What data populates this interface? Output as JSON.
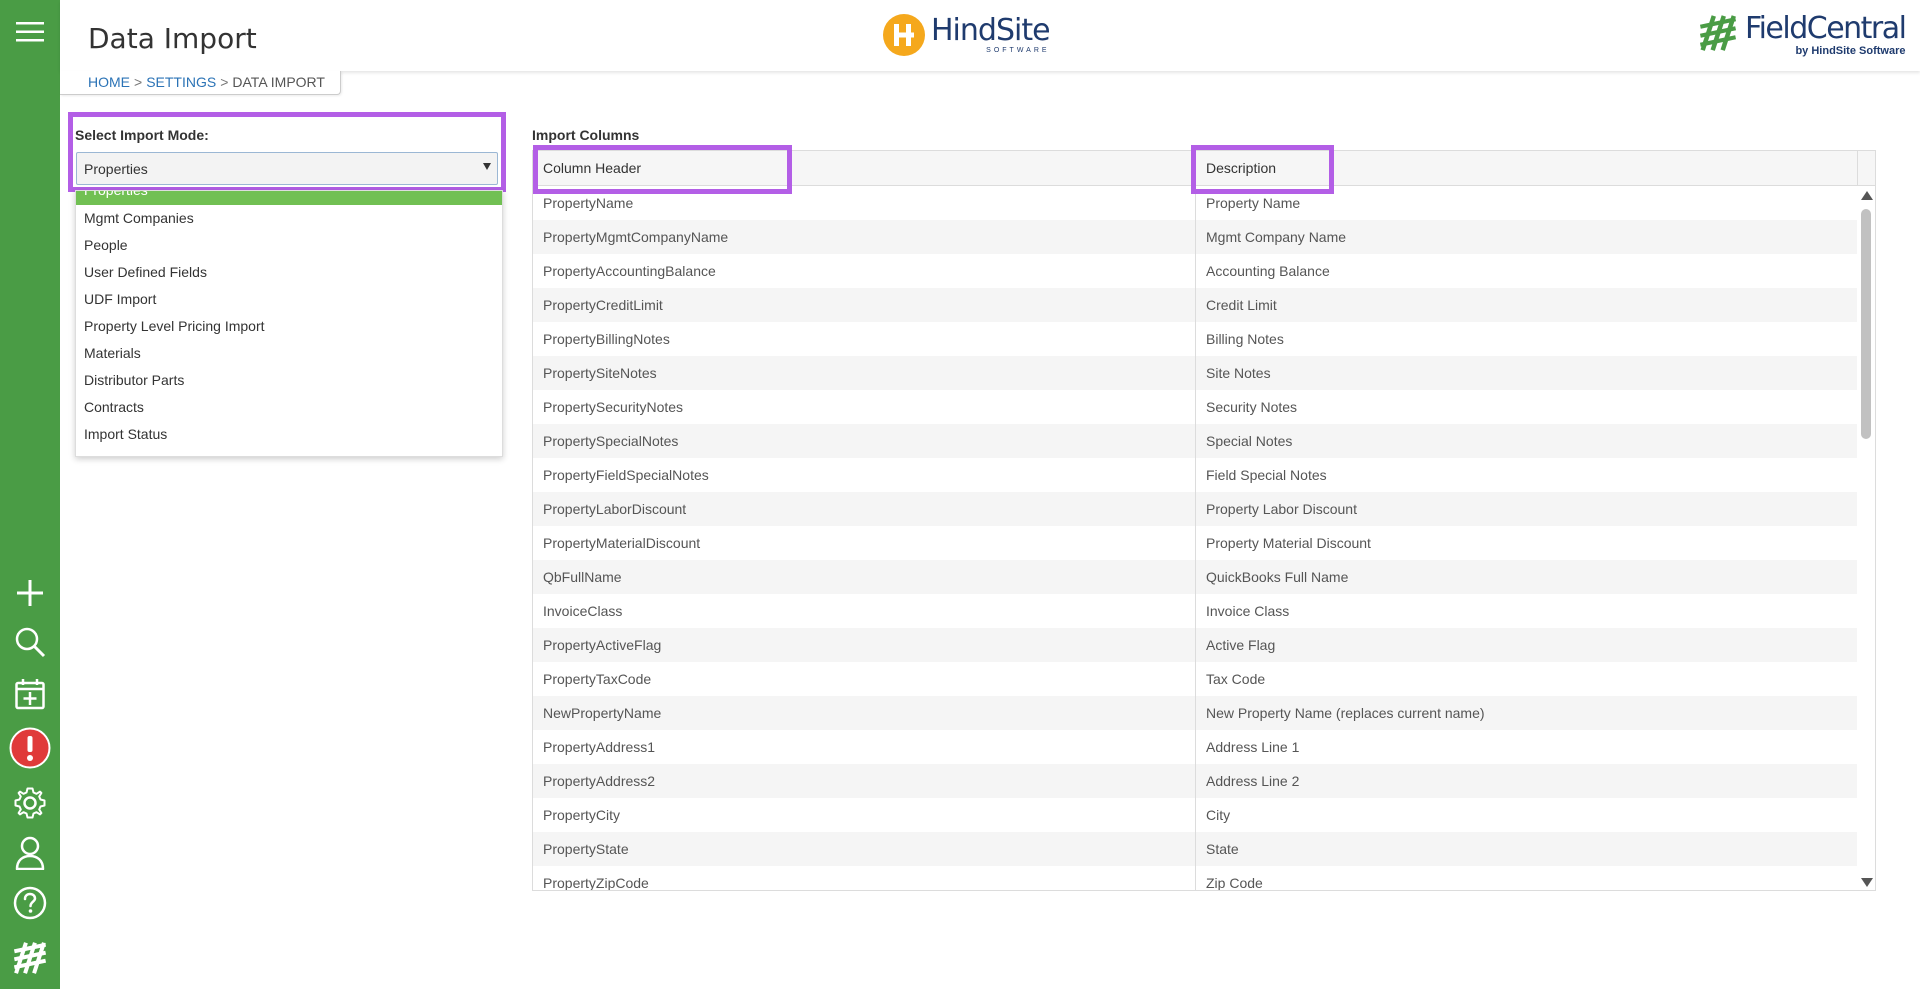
{
  "header": {
    "title": "Data Import",
    "hindsite_logo": {
      "main": "HindSite",
      "sub": "SOFTWARE"
    },
    "fieldcentral_logo": {
      "main": "FieldCentral",
      "sub": "by HindSite Software"
    }
  },
  "breadcrumb": {
    "home": "HOME",
    "settings": "SETTINGS",
    "current": "DATA IMPORT",
    "separator": ">"
  },
  "import_mode": {
    "label": "Select Import Mode:",
    "selected": "Properties",
    "options": [
      "Properties",
      "Mgmt Companies",
      "People",
      "User Defined Fields",
      "UDF Import",
      "Property Level Pricing Import",
      "Materials",
      "Distributor Parts",
      "Contracts",
      "Import Status"
    ]
  },
  "import_columns": {
    "label": "Import Columns",
    "headers": {
      "column": "Column Header",
      "description": "Description"
    },
    "rows": [
      [
        "PropertyName",
        "Property Name"
      ],
      [
        "PropertyMgmtCompanyName",
        "Mgmt Company Name"
      ],
      [
        "PropertyAccountingBalance",
        "Accounting Balance"
      ],
      [
        "PropertyCreditLimit",
        "Credit Limit"
      ],
      [
        "PropertyBillingNotes",
        "Billing Notes"
      ],
      [
        "PropertySiteNotes",
        "Site Notes"
      ],
      [
        "PropertySecurityNotes",
        "Security Notes"
      ],
      [
        "PropertySpecialNotes",
        "Special Notes"
      ],
      [
        "PropertyFieldSpecialNotes",
        "Field Special Notes"
      ],
      [
        "PropertyLaborDiscount",
        "Property Labor Discount"
      ],
      [
        "PropertyMaterialDiscount",
        "Property Material Discount"
      ],
      [
        "QbFullName",
        "QuickBooks Full Name"
      ],
      [
        "InvoiceClass",
        "Invoice Class"
      ],
      [
        "PropertyActiveFlag",
        "Active Flag"
      ],
      [
        "PropertyTaxCode",
        "Tax Code"
      ],
      [
        "NewPropertyName",
        "New Property Name (replaces current name)"
      ],
      [
        "PropertyAddress1",
        "Address Line 1"
      ],
      [
        "PropertyAddress2",
        "Address Line 2"
      ],
      [
        "PropertyCity",
        "City"
      ],
      [
        "PropertyState",
        "State"
      ],
      [
        "PropertyZipCode",
        "Zip Code"
      ]
    ]
  },
  "sidebar": {
    "icons": [
      "menu-icon",
      "plus-icon",
      "search-icon",
      "calendar-add-icon",
      "alert-icon",
      "gear-icon",
      "user-icon",
      "help-icon",
      "fieldcentral-mark-icon"
    ]
  },
  "colors": {
    "sidebar": "#4a9c45",
    "selected_option": "#71c053",
    "highlight": "#b35ee6",
    "alert": "#e03a3a",
    "link": "#2b73b6",
    "brand_navy": "#1f3b6e",
    "brand_orange": "#f5a81c"
  }
}
